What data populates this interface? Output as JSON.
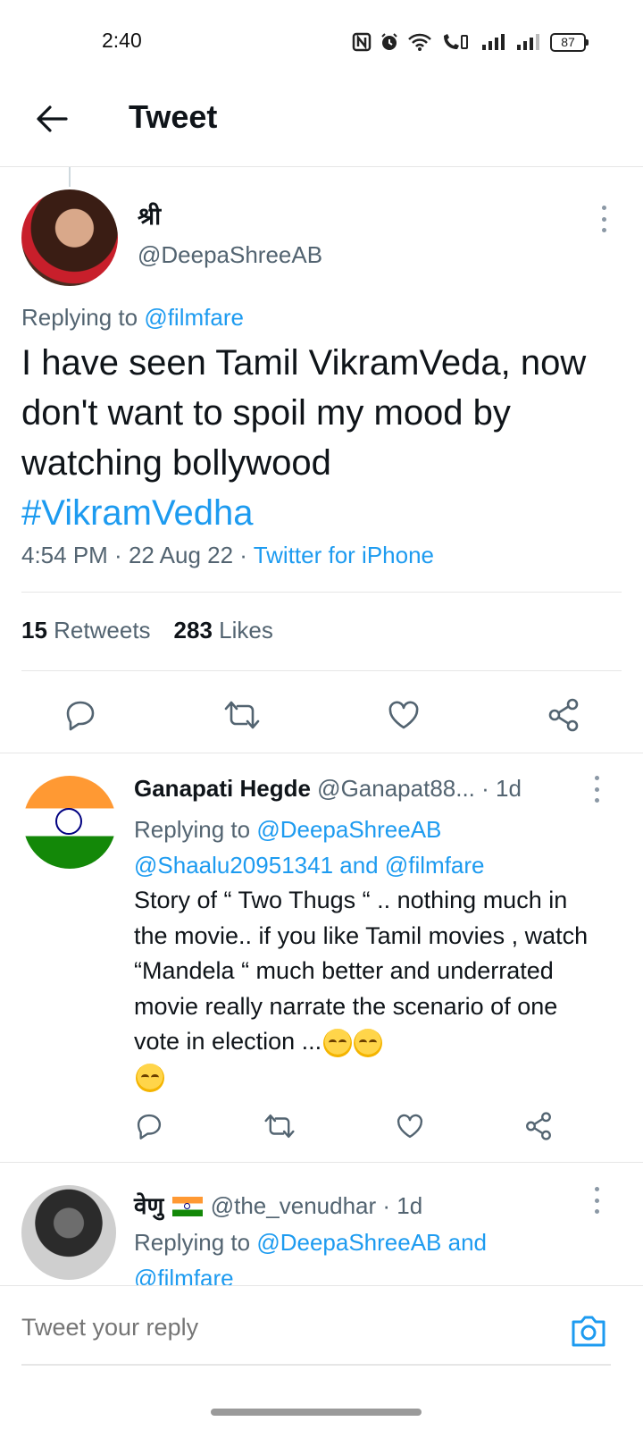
{
  "status_bar": {
    "time": "2:40",
    "battery": "87",
    "icons": [
      "nfc-icon",
      "alarm-icon",
      "wifi-icon",
      "call-wifi-icon",
      "signal-icon",
      "signal-icon-2",
      "battery-icon"
    ]
  },
  "header": {
    "title": "Tweet",
    "back_icon": "arrow-left-icon"
  },
  "tweet": {
    "name": "श्री",
    "handle": "@DeepaShreeAB",
    "replying_prefix": "Replying to ",
    "replying_to": "@filmfare",
    "text": "I have seen Tamil VikramVeda, now don't want to spoil my mood by watching bollywood",
    "hashtag": "#VikramVedha",
    "time": "4:54 PM",
    "date": "22 Aug 22",
    "source": "Twitter for iPhone",
    "retweets_count": "15",
    "retweets_label": "Retweets",
    "likes_count": "283",
    "likes_label": "Likes"
  },
  "replies": [
    {
      "name": "Ganapati Hegde",
      "handle": "@Ganapat88...",
      "age": "· 1d",
      "replying_prefix": "Replying to ",
      "replying_to_1": "@DeepaShreeAB",
      "replying_to_2": "@Shaalu20951341",
      "replying_and": " and ",
      "replying_to_3": "@filmfare",
      "text": "Story of “ Two Thugs “ .. nothing much in the movie.. if you like Tamil movies , watch “Mandela “ much better and underrated movie really narrate the scenario of one vote in election ..."
    },
    {
      "name": "वेणु",
      "handle": "@the_venudhar",
      "age": "· 1d",
      "replying_prefix": "Replying to ",
      "replying_to_1": "@DeepaShreeAB",
      "replying_and": " and",
      "replying_to_2": "@filmfare"
    }
  ],
  "composer": {
    "placeholder": "Tweet your reply"
  },
  "colors": {
    "accent": "#1d9bf0",
    "text": "#0f1419",
    "muted": "#536471",
    "divider": "#e6e6e6"
  }
}
